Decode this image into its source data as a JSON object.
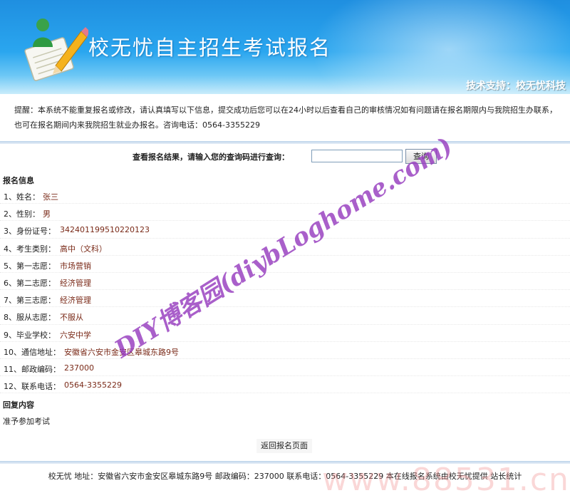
{
  "banner": {
    "title": "校无忧自主招生考试报名",
    "support": "技术支持：校无忧科技"
  },
  "notice": {
    "text": "提醒：本系统不能重复报名或修改，请认真填写以下信息，提交成功后您可以在24小时以后查看自己的审核情况如有问题请在报名期限内与我院招生办联系，也可在报名期间内来我院招生就业办报名。咨询电话：0564-3355229"
  },
  "query": {
    "label": "查看报名结果，请输入您的查询码进行查询：",
    "input_value": "",
    "button_label": "查询"
  },
  "info": {
    "heading": "报名信息",
    "rows": [
      {
        "label": "1、姓名：",
        "value": "张三"
      },
      {
        "label": "2、性别：",
        "value": "男"
      },
      {
        "label": "3、身份证号：",
        "value": "342401199510220123"
      },
      {
        "label": "4、考生类别：",
        "value": "高中（文科）"
      },
      {
        "label": "5、第一志愿：",
        "value": "市场营销"
      },
      {
        "label": "6、第二志愿：",
        "value": "经济管理"
      },
      {
        "label": "7、第三志愿：",
        "value": "经济管理"
      },
      {
        "label": "8、服从志愿：",
        "value": "不服从"
      },
      {
        "label": "9、毕业学校：",
        "value": "六安中学"
      },
      {
        "label": "10、通信地址：",
        "value": "安徽省六安市金安区皋城东路9号"
      },
      {
        "label": "11、邮政编码：",
        "value": "237000"
      },
      {
        "label": "12、联系电话：",
        "value": "0564-3355229"
      }
    ]
  },
  "reply": {
    "heading": "回复内容",
    "text": "准予参加考试"
  },
  "back_label": "返回报名页面",
  "footer": {
    "text": "校无忧  地址：安徽省六安市金安区皋城东路9号  邮政编码：237000  联系电话：0564-3355229  本在线报名系统由校无忧提供  站长统计"
  },
  "watermark": {
    "text": "DIY博客园(diybLoghome.com)",
    "site": "www.88531.cn"
  },
  "colors": {
    "banner_top": "#1f8fe0",
    "value_text": "#7a2a18",
    "watermark": "#963cbe"
  }
}
